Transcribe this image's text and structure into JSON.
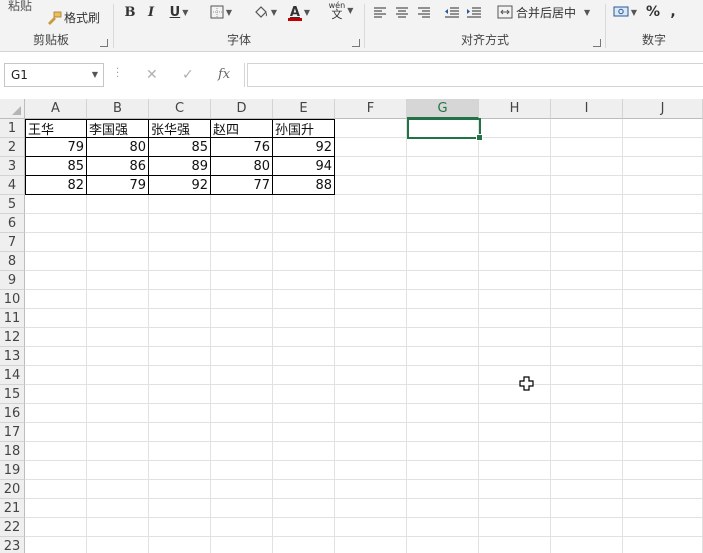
{
  "ribbon": {
    "clipboard": {
      "paste_label": "粘贴",
      "format_painter_label": "格式刷",
      "group_label": "剪贴板"
    },
    "font": {
      "bold": "B",
      "italic": "I",
      "underline": "U",
      "font_color_glyph": "A",
      "phonetic_top": "wén",
      "phonetic_bottom": "文",
      "group_label": "字体"
    },
    "alignment": {
      "merge_center_label": "合并后居中",
      "group_label": "对齐方式"
    },
    "number": {
      "percent": "%",
      "comma": ",",
      "group_label": "数字"
    }
  },
  "formula_bar": {
    "name_box": "G1",
    "fx_label": "fx",
    "formula": ""
  },
  "columns": [
    "A",
    "B",
    "C",
    "D",
    "E",
    "F",
    "G",
    "H",
    "I",
    "J"
  ],
  "selected_column": "G",
  "rows": [
    "1",
    "2",
    "3",
    "4",
    "5",
    "6",
    "7",
    "8",
    "9",
    "10",
    "11",
    "12",
    "13",
    "14",
    "15",
    "16",
    "17",
    "18",
    "19",
    "20",
    "21",
    "22",
    "23"
  ],
  "table": {
    "headers": [
      "王华",
      "李国强",
      "张华强",
      "赵四",
      "孙国升"
    ],
    "data": [
      [
        "79",
        "80",
        "85",
        "76",
        "92"
      ],
      [
        "85",
        "86",
        "89",
        "80",
        "94"
      ],
      [
        "82",
        "79",
        "92",
        "77",
        "88"
      ]
    ]
  },
  "colors": {
    "accent": "#217346"
  },
  "icons": [
    "format-painter-icon",
    "border-icon",
    "fill-color-icon",
    "font-color-icon",
    "phonetic-icon",
    "align-left-icon",
    "align-center-icon",
    "align-right-icon",
    "decrease-indent-icon",
    "increase-indent-icon",
    "merge-center-icon",
    "accounting-format-icon",
    "cancel-icon",
    "enter-icon",
    "fx-icon",
    "cell-cursor-icon"
  ]
}
